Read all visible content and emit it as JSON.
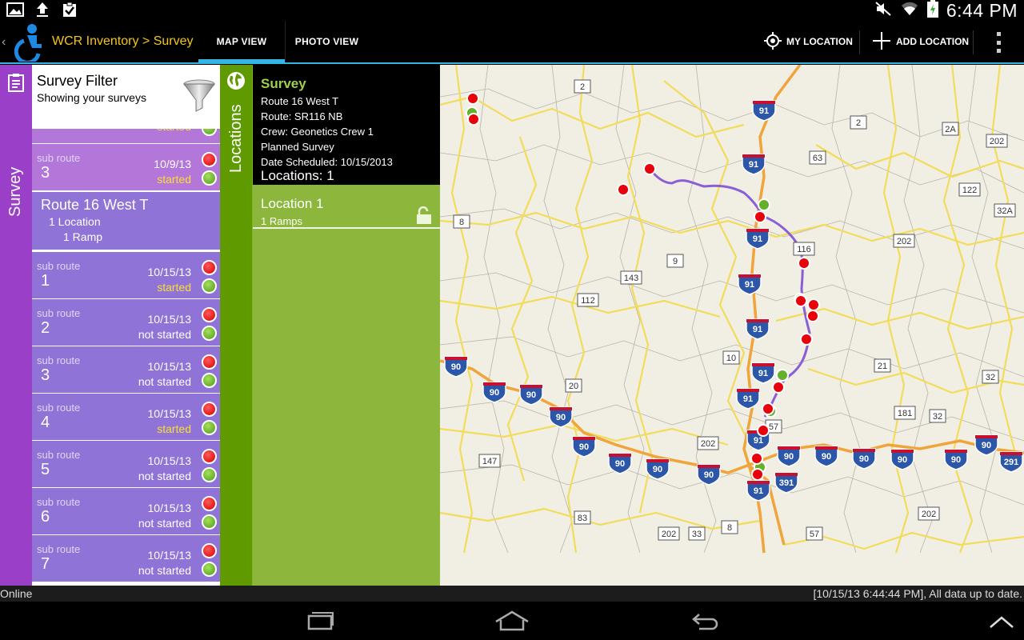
{
  "status_bar": {
    "time": "6:44 PM"
  },
  "app": {
    "title": "WCR Inventory > Survey",
    "tabs": [
      {
        "label": "MAP VIEW",
        "selected": true
      },
      {
        "label": "PHOTO VIEW",
        "selected": false
      }
    ],
    "actions": {
      "my_location": "MY LOCATION",
      "add_location": "ADD LOCATION"
    },
    "accent_color": "#33b5e5"
  },
  "survey_tab": {
    "label": "Survey",
    "color": "#9a3fc8"
  },
  "filter": {
    "title": "Survey Filter",
    "subtitle": "Showing your surveys"
  },
  "list": {
    "partial_top": {
      "state": "started"
    },
    "item_pink": {
      "label": "sub route",
      "number": "3",
      "date": "10/9/13",
      "state": "started"
    },
    "route": {
      "title": "Route 16 West T",
      "locations": "1 Location",
      "ramps": "1 Ramp"
    },
    "subroutes": [
      {
        "label": "sub route",
        "number": "1",
        "date": "10/15/13",
        "state": "started"
      },
      {
        "label": "sub route",
        "number": "2",
        "date": "10/15/13",
        "state": "not started"
      },
      {
        "label": "sub route",
        "number": "3",
        "date": "10/15/13",
        "state": "not started"
      },
      {
        "label": "sub route",
        "number": "4",
        "date": "10/15/13",
        "state": "started"
      },
      {
        "label": "sub route",
        "number": "5",
        "date": "10/15/13",
        "state": "not started"
      },
      {
        "label": "sub route",
        "number": "6",
        "date": "10/15/13",
        "state": "not started"
      },
      {
        "label": "sub route",
        "number": "7",
        "date": "10/15/13",
        "state": "not started"
      }
    ]
  },
  "locations_tab": {
    "label": "Locations",
    "color": "#5e9a00"
  },
  "survey_info": {
    "heading": "Survey",
    "route_name": "Route 16 West T",
    "route": "Route: SR116 NB",
    "crew": "Crew: Geonetics Crew 1",
    "type": "Planned Survey",
    "scheduled": "Date Scheduled: 10/15/2013",
    "locations": "Locations: 1"
  },
  "location_item": {
    "name": "Location 1",
    "detail": "1 Ramps"
  },
  "map": {
    "shields": {
      "interstate": [
        "91",
        "91",
        "91",
        "91",
        "91",
        "91",
        "91",
        "91",
        "91",
        "90",
        "90",
        "90",
        "90",
        "90",
        "90",
        "90",
        "90",
        "90",
        "90",
        "90",
        "90",
        "90",
        "90",
        "291",
        "391"
      ],
      "state": [
        "2",
        "2",
        "2A",
        "202",
        "63",
        "122",
        "32A",
        "202",
        "8",
        "9",
        "143",
        "112",
        "116",
        "10",
        "20",
        "202",
        "21",
        "181",
        "32",
        "202",
        "33",
        "8",
        "57",
        "202",
        "57",
        "147",
        "83",
        "32"
      ]
    }
  },
  "bottom_status": {
    "left": "Online",
    "right": "[10/15/13 6:44:44 PM], All data up to date."
  }
}
